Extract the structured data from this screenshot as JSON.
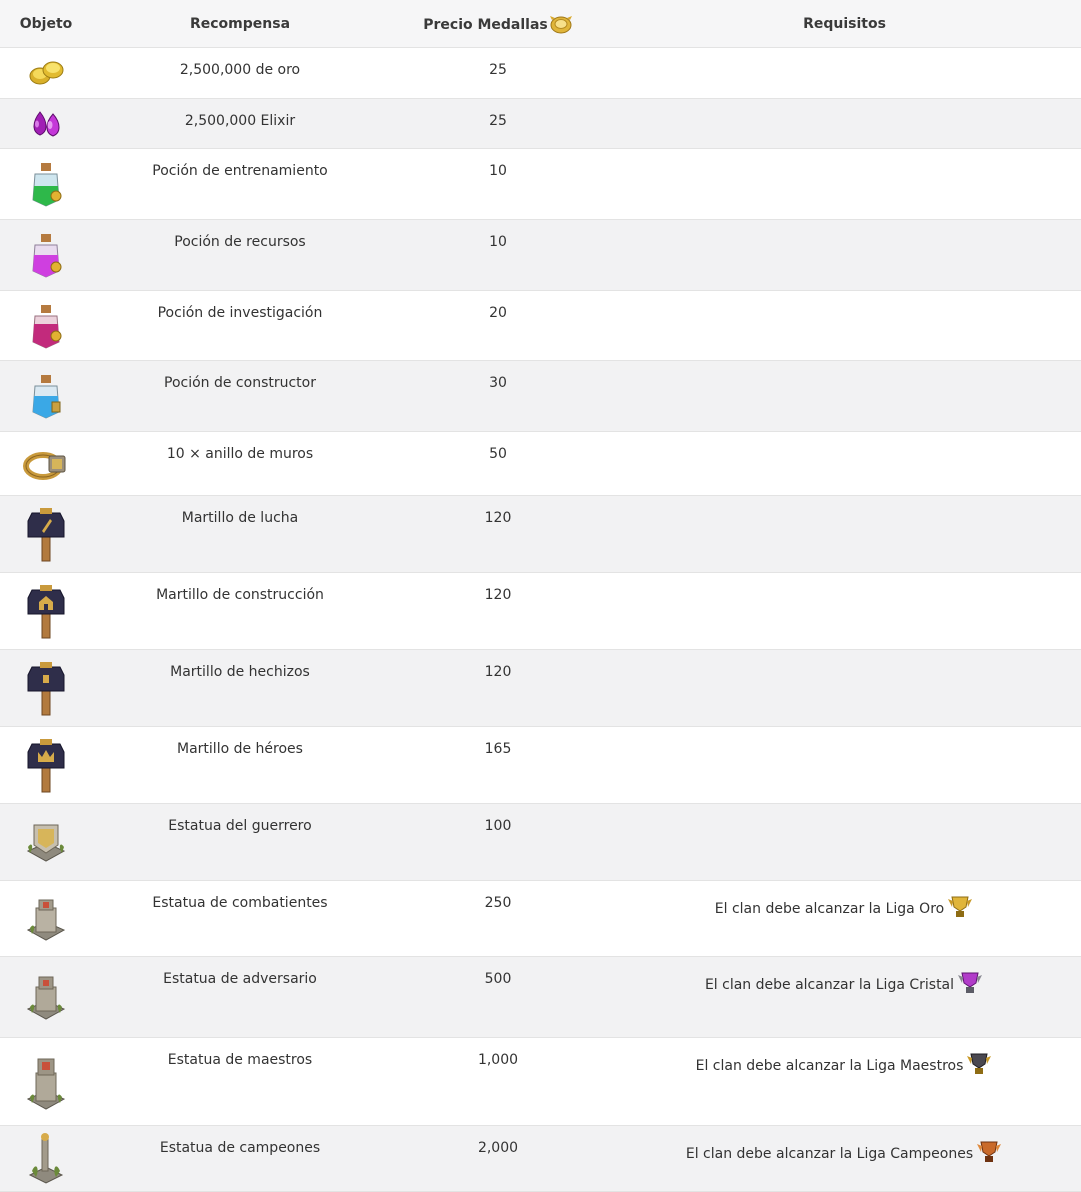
{
  "headers": {
    "object": "Objeto",
    "reward": "Recompensa",
    "price": "Precio Medallas",
    "requirements": "Requisitos"
  },
  "colors": {
    "gold": "#e6c23a",
    "elixir": "#b12bc4",
    "dark": "#2f2e4a",
    "wood": "#b27a3e",
    "stone": "#9b9488",
    "moss": "#6b8a3a"
  },
  "rows": [
    {
      "icon": "gold-coins-icon",
      "reward": "2,500,000 de oro",
      "price": "25",
      "req": ""
    },
    {
      "icon": "elixir-drops-icon",
      "reward": "2,500,000 Elixir",
      "price": "25",
      "req": ""
    },
    {
      "icon": "training-potion-icon",
      "reward": "Poción de entrenamiento",
      "price": "10",
      "req": ""
    },
    {
      "icon": "resource-potion-icon",
      "reward": "Poción de recursos",
      "price": "10",
      "req": ""
    },
    {
      "icon": "research-potion-icon",
      "reward": "Poción de investigación",
      "price": "20",
      "req": ""
    },
    {
      "icon": "builder-potion-icon",
      "reward": "Poción de constructor",
      "price": "30",
      "req": ""
    },
    {
      "icon": "wall-ring-icon",
      "reward": "10 × anillo de muros",
      "price": "50",
      "req": ""
    },
    {
      "icon": "fighting-hammer-icon",
      "reward": "Martillo de lucha",
      "price": "120",
      "req": ""
    },
    {
      "icon": "building-hammer-icon",
      "reward": "Martillo de construcción",
      "price": "120",
      "req": ""
    },
    {
      "icon": "spell-hammer-icon",
      "reward": "Martillo de hechizos",
      "price": "120",
      "req": ""
    },
    {
      "icon": "hero-hammer-icon",
      "reward": "Martillo de héroes",
      "price": "165",
      "req": ""
    },
    {
      "icon": "warrior-statue-icon",
      "reward": "Estatua del guerrero",
      "price": "100",
      "req": ""
    },
    {
      "icon": "fighters-statue-icon",
      "reward": "Estatua de combatientes",
      "price": "250",
      "req": "El clan debe alcanzar la Liga Oro",
      "league": "gold-league-icon"
    },
    {
      "icon": "adversary-statue-icon",
      "reward": "Estatua de adversario",
      "price": "500",
      "req": "El clan debe alcanzar la Liga Cristal",
      "league": "crystal-league-icon"
    },
    {
      "icon": "masters-statue-icon",
      "reward": "Estatua de maestros",
      "price": "1,000",
      "req": "El clan debe alcanzar la Liga Maestros",
      "league": "master-league-icon"
    },
    {
      "icon": "champions-statue-icon",
      "reward": "Estatua de campeones",
      "price": "2,000",
      "req": "El clan debe alcanzar la Liga Campeones",
      "league": "champion-league-icon"
    }
  ]
}
